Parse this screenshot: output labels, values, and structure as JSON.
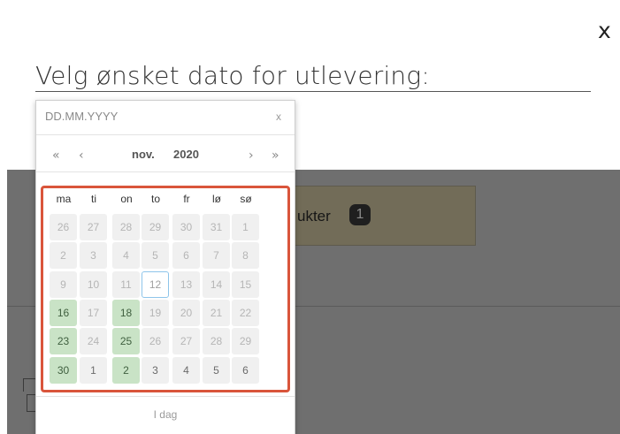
{
  "modal": {
    "close_label": "x",
    "heading": "Velg ønsket dato for utlevering:"
  },
  "background": {
    "product_label": "ukter",
    "product_count": "1"
  },
  "datepicker": {
    "input": {
      "value": "",
      "placeholder": "DD.MM.YYYY",
      "clear_label": "x"
    },
    "nav": {
      "prev_year": "«",
      "prev_month": "‹",
      "next_month": "›",
      "next_year": "»"
    },
    "month": "nov.",
    "year": "2020",
    "weekdays": [
      "ma",
      "ti",
      "on",
      "to",
      "fr",
      "lø",
      "sø"
    ],
    "weeks": [
      [
        {
          "d": "26",
          "s": "muted"
        },
        {
          "d": "27",
          "s": "muted"
        },
        {
          "d": "28",
          "s": "muted"
        },
        {
          "d": "29",
          "s": "muted"
        },
        {
          "d": "30",
          "s": "muted"
        },
        {
          "d": "31",
          "s": "muted"
        },
        {
          "d": "1",
          "s": "muted"
        }
      ],
      [
        {
          "d": "2",
          "s": "muted"
        },
        {
          "d": "3",
          "s": "muted"
        },
        {
          "d": "4",
          "s": "muted"
        },
        {
          "d": "5",
          "s": "muted"
        },
        {
          "d": "6",
          "s": "muted"
        },
        {
          "d": "7",
          "s": "muted"
        },
        {
          "d": "8",
          "s": "muted"
        }
      ],
      [
        {
          "d": "9",
          "s": "muted"
        },
        {
          "d": "10",
          "s": "muted"
        },
        {
          "d": "11",
          "s": "muted"
        },
        {
          "d": "12",
          "s": "today"
        },
        {
          "d": "13",
          "s": "muted"
        },
        {
          "d": "14",
          "s": "muted"
        },
        {
          "d": "15",
          "s": "muted"
        }
      ],
      [
        {
          "d": "16",
          "s": "available"
        },
        {
          "d": "17",
          "s": "muted"
        },
        {
          "d": "18",
          "s": "available"
        },
        {
          "d": "19",
          "s": "muted"
        },
        {
          "d": "20",
          "s": "muted"
        },
        {
          "d": "21",
          "s": "muted"
        },
        {
          "d": "22",
          "s": "muted"
        }
      ],
      [
        {
          "d": "23",
          "s": "available"
        },
        {
          "d": "24",
          "s": "muted"
        },
        {
          "d": "25",
          "s": "available"
        },
        {
          "d": "26",
          "s": "muted"
        },
        {
          "d": "27",
          "s": "muted"
        },
        {
          "d": "28",
          "s": "muted"
        },
        {
          "d": "29",
          "s": "muted"
        }
      ],
      [
        {
          "d": "30",
          "s": "available"
        },
        {
          "d": "1",
          "s": "normal"
        },
        {
          "d": "2",
          "s": "available"
        },
        {
          "d": "3",
          "s": "normal"
        },
        {
          "d": "4",
          "s": "normal"
        },
        {
          "d": "5",
          "s": "normal"
        },
        {
          "d": "6",
          "s": "normal"
        }
      ]
    ],
    "today_label": "I dag"
  },
  "colors": {
    "highlight_border": "#d9553b",
    "available_bg": "#c9e3c6",
    "today_border": "#8ec5ea",
    "overlay": "#6f6f6f"
  }
}
